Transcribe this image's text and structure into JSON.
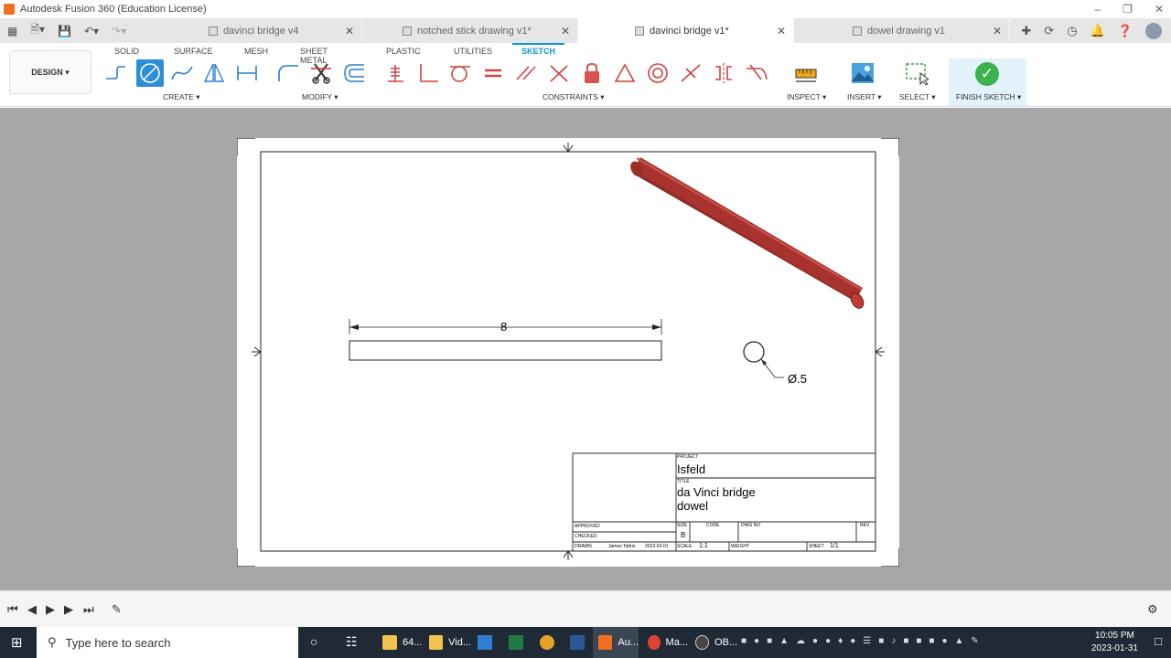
{
  "window": {
    "title": "Autodesk Fusion 360 (Education License)"
  },
  "doc_tabs": [
    {
      "label": "davinci bridge v4",
      "active": false
    },
    {
      "label": "notched stick drawing v1*",
      "active": false
    },
    {
      "label": "davinci bridge v1*",
      "active": true
    },
    {
      "label": "dowel drawing v1",
      "active": false
    }
  ],
  "workspace_tabs": [
    "SOLID",
    "SURFACE",
    "MESH",
    "SHEET METAL",
    "PLASTIC",
    "UTILITIES",
    "SKETCH"
  ],
  "toolbar": {
    "design_label": "DESIGN ▾",
    "create_label": "CREATE ▾",
    "modify_label": "MODIFY ▾",
    "constraints_label": "CONSTRAINTS ▾",
    "inspect_label": "INSPECT ▾",
    "insert_label": "INSERT ▾",
    "select_label": "SELECT ▾",
    "finish_label": "FINISH SKETCH ▾"
  },
  "drawing": {
    "dimension_length": "8",
    "dimension_diameter": "Ø.5",
    "title_block": {
      "project_label": "PROJECT",
      "project": "Isfeld",
      "title_label": "TITLE",
      "title_line1": "da Vinci bridge",
      "title_line2": "dowel",
      "approved_label": "APPROVED",
      "checked_label": "CHECKED",
      "drawn_label": "DRAWN",
      "drawn_by": "James Tattris",
      "drawn_date": "2023-02-01",
      "size_label": "SIZE",
      "size": "B",
      "code_label": "CODE",
      "dwg_no_label": "DWG NO",
      "rev_label": "REV",
      "scale_label": "SCALE",
      "scale": "1:1",
      "weight_label": "WEIGHT",
      "sheet_label": "SHEET",
      "sheet": "1/1"
    }
  },
  "taskbar": {
    "search_placeholder": "Type here to search",
    "apps": [
      "64...",
      "Vid...",
      "Au...",
      "Ma...",
      "OB..."
    ],
    "time": "10:05 PM",
    "date": "2023-01-31"
  },
  "colors": {
    "accent": "#0696d7",
    "dowel": "#a8322d",
    "canvas": "#a7a7a7",
    "finish_green": "#3ab44a"
  }
}
